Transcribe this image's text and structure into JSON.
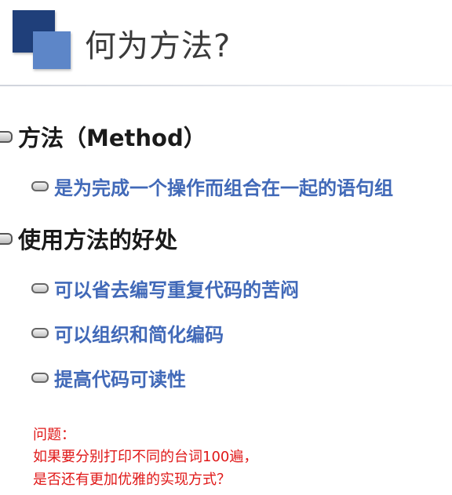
{
  "title": "何为方法?",
  "bullets": [
    {
      "text": "方法（Method）",
      "children": [
        "是为完成一个操作而组合在一起的语句组"
      ]
    },
    {
      "text": "使用方法的好处",
      "children": [
        "可以省去编写重复代码的苦闷",
        "可以组织和简化编码",
        "提高代码可读性"
      ]
    }
  ],
  "note": {
    "line1": "问题：",
    "line2": "如果要分别打印不同的台词100遍，",
    "line3": "是否还有更加优雅的实现方式？"
  },
  "colors": {
    "title": "#3a3a3a",
    "level1": "#1a1a1a",
    "level2": "#4169b8",
    "note": "#e01818",
    "logo_dark": "#1f3f7a",
    "logo_light": "#5d86c8"
  }
}
